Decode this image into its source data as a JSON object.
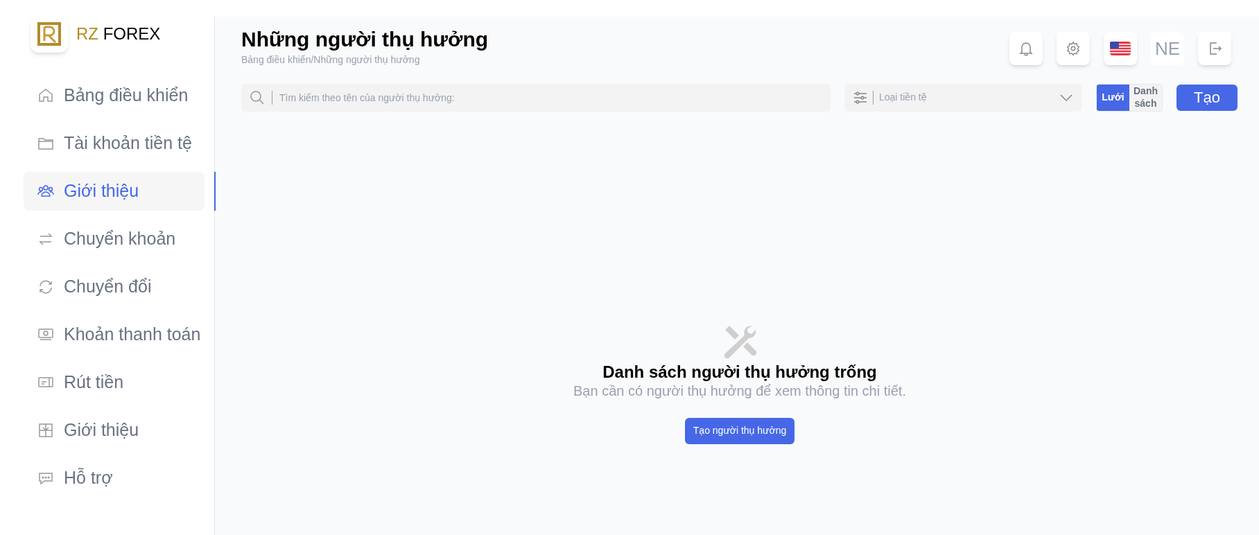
{
  "brand": {
    "prefix": "RZ",
    "name": "FOREX"
  },
  "sidebar": {
    "items": [
      {
        "label": "Bảng điều khiển",
        "selected": false
      },
      {
        "label": "Tài khoản tiền tệ",
        "selected": false
      },
      {
        "label": "Giới thiệu",
        "selected": true
      },
      {
        "label": "Chuyển khoản",
        "selected": false
      },
      {
        "label": "Chuyển đổi",
        "selected": false
      },
      {
        "label": "Khoản thanh toán",
        "selected": false
      },
      {
        "label": "Rút tiền",
        "selected": false
      },
      {
        "label": "Giới thiệu",
        "selected": false
      },
      {
        "label": "Hỗ trợ",
        "selected": false
      }
    ]
  },
  "header": {
    "title": "Những người thụ hưởng",
    "breadcrumb": "Bảng điều khiển/Những người thụ hưởng",
    "language": "NE"
  },
  "toolbar": {
    "search": {
      "placeholder": "Tìm kiếm theo tên của người thụ hưởng:"
    },
    "currency_filter": {
      "placeholder": "Loại tiền tệ"
    },
    "views": [
      {
        "label": "Lưới",
        "selected": true
      },
      {
        "label": "Danh sách",
        "selected": false
      }
    ],
    "create_button": "Tạo"
  },
  "empty_state": {
    "title": "Danh sách người thụ hưởng trống",
    "message": "Bạn cần có người thụ hưởng để xem thông tin chi tiết.",
    "button": "Tạo người thụ hưởng"
  }
}
